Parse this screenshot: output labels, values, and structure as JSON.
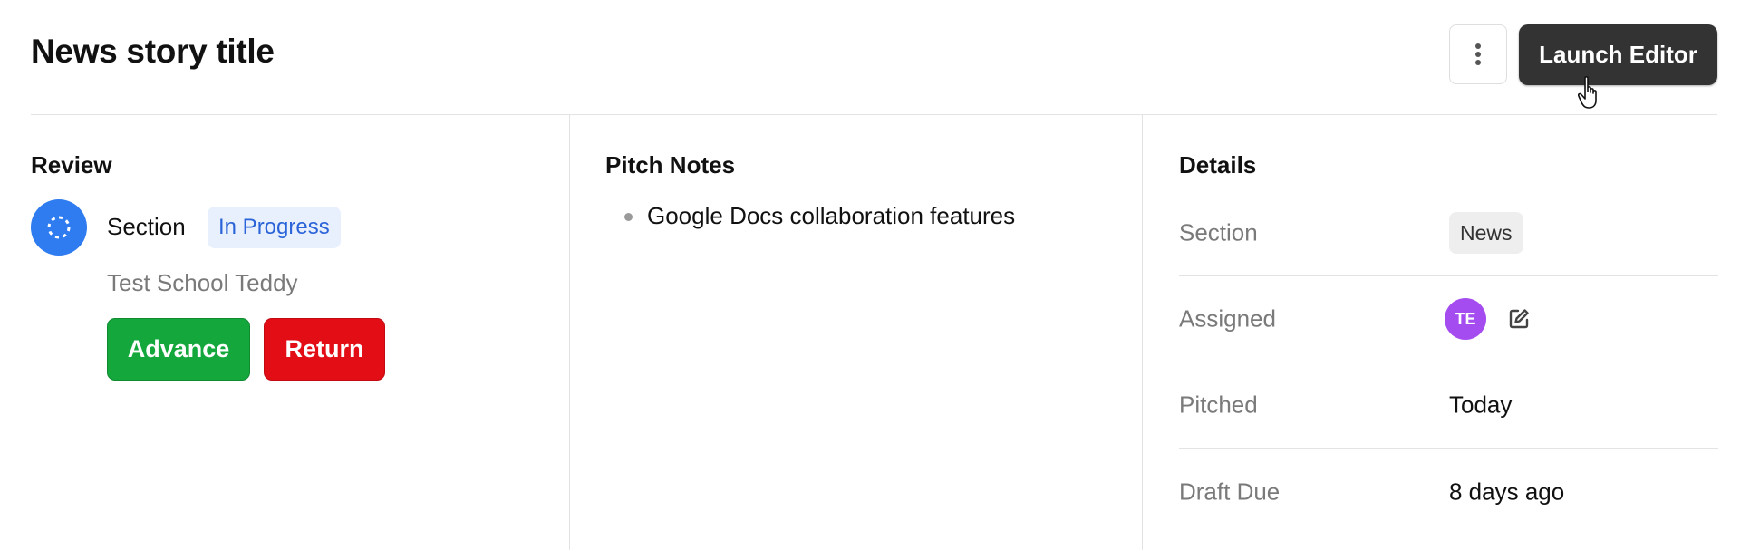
{
  "header": {
    "title": "News story title",
    "more_icon": "more-vertical-icon",
    "launch_label": "Launch Editor"
  },
  "review": {
    "heading": "Review",
    "icon": "dashed-circle-icon",
    "section_label": "Section",
    "status": "In Progress",
    "reviewer": "Test School Teddy",
    "advance_label": "Advance",
    "return_label": "Return"
  },
  "pitch": {
    "heading": "Pitch Notes",
    "notes": [
      "Google Docs collaboration features"
    ]
  },
  "details": {
    "heading": "Details",
    "rows": [
      {
        "label": "Section",
        "value": "News"
      },
      {
        "label": "Assigned",
        "value": "TE"
      },
      {
        "label": "Pitched",
        "value": "Today"
      },
      {
        "label": "Draft Due",
        "value": "8 days ago"
      }
    ],
    "edit_icon": "edit-icon"
  },
  "colors": {
    "primary_dark": "#333333",
    "advance_green": "#13a73c",
    "return_red": "#e20d15",
    "status_blue": "#2a64d8",
    "status_bg": "#e8effd",
    "icon_blue": "#2f7bf0",
    "avatar_purple": "#a44cf0"
  }
}
